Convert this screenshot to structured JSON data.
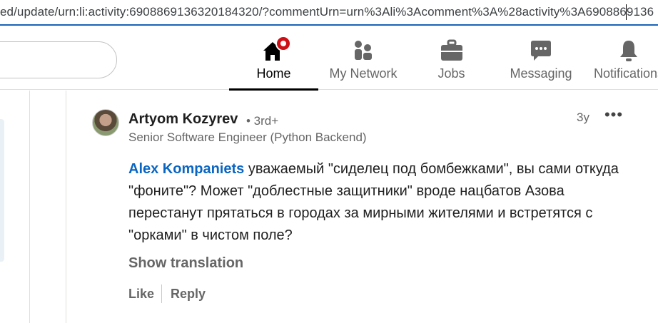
{
  "browser": {
    "url": "ed/update/urn:li:activity:6908869136320184320/?commentUrn=urn%3Ali%3Acomment%3A%28activity%3A6908869136"
  },
  "topnav": {
    "items": [
      {
        "label": "Home",
        "icon": "home-icon",
        "active": true
      },
      {
        "label": "My Network",
        "icon": "network-icon",
        "active": false
      },
      {
        "label": "Jobs",
        "icon": "briefcase-icon",
        "active": false
      },
      {
        "label": "Messaging",
        "icon": "chat-bubble-icon",
        "active": false
      },
      {
        "label": "Notifications",
        "icon": "bell-icon",
        "active": false
      }
    ],
    "accent_color": "#cc1016"
  },
  "comment": {
    "author": "Artyom Kozyrev",
    "degree": "• 3rd+",
    "headline": "Senior Software Engineer (Python Backend)",
    "timestamp": "3y",
    "mention": "Alex Kompaniets",
    "text": " уважаемый \"сиделец под бомбежками\", вы сами откуда \"фоните\"? Может \"доблестные защитники\" вроде нацбатов Азова перестанут прятаться в городах за мирными жителями и встретятся с \"орками\" в чистом поле?",
    "mention_color": "#0a66c2",
    "show_translation": "Show translation",
    "actions": {
      "like": "Like",
      "reply": "Reply"
    }
  }
}
